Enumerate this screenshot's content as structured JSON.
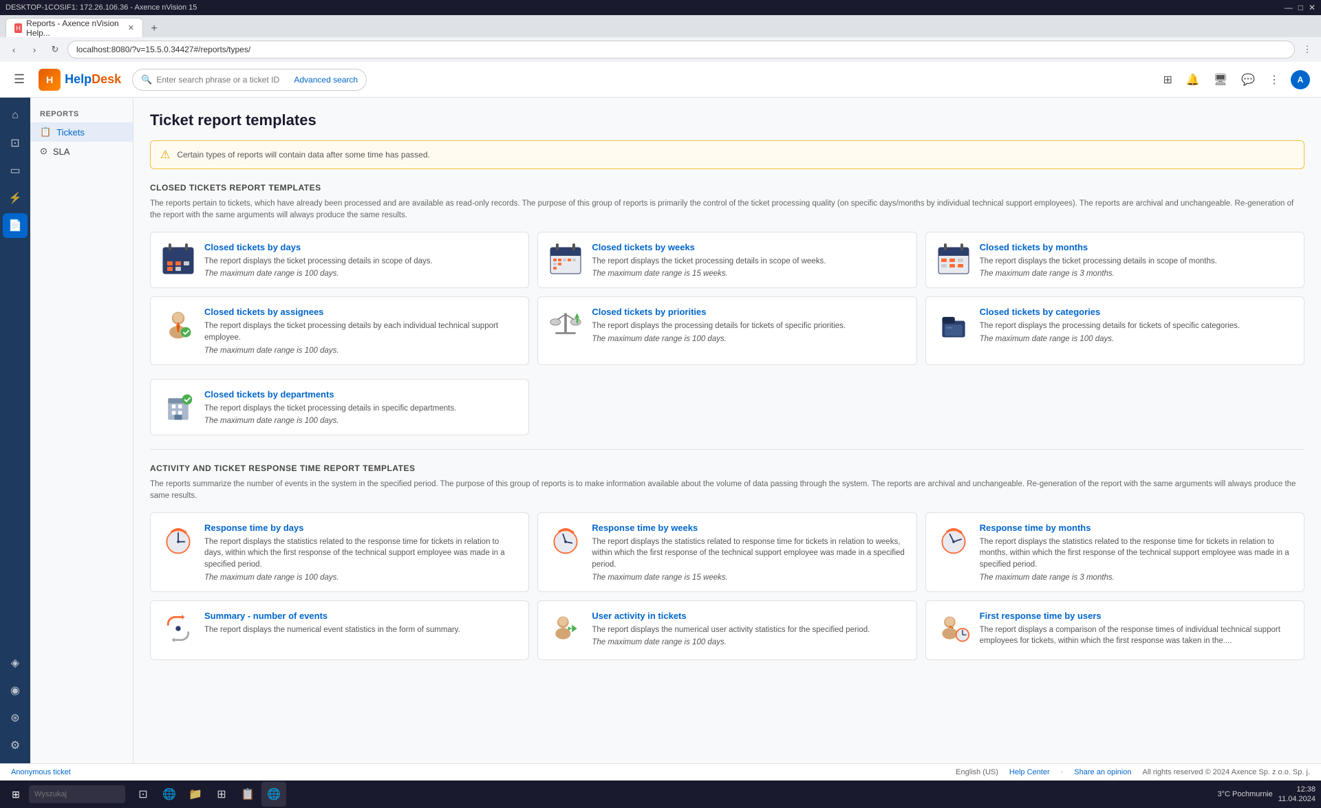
{
  "os": {
    "title": "DESKTOP-1COSIF1: 172.26.106.36 - Axence nVision 15",
    "controls": [
      "—",
      "□",
      "✕"
    ]
  },
  "browser": {
    "tab_label": "Reports - Axence nVision Help...",
    "address": "localhost:8080/?v=15.5.0.34427#/reports/types/",
    "back_btn": "‹",
    "forward_btn": "›",
    "reload_btn": "↻"
  },
  "header": {
    "menu_icon": "☰",
    "logo_text": "HelpDesk",
    "search_placeholder": "Enter search phrase or a ticket ID",
    "advanced_search_label": "Advanced search",
    "icons": {
      "grid": "⊞",
      "bell": "🔔",
      "monitor": "🖥",
      "chat": "💬",
      "apps": "⋮⋮"
    },
    "avatar_label": "A"
  },
  "icon_sidebar": {
    "items": [
      {
        "name": "home",
        "icon": "⌂",
        "active": false
      },
      {
        "name": "map",
        "icon": "⊡",
        "active": false
      },
      {
        "name": "screen",
        "icon": "▭",
        "active": false
      },
      {
        "name": "alert",
        "icon": "⚡",
        "active": false
      },
      {
        "name": "document",
        "icon": "📄",
        "active": true
      },
      {
        "name": "agent",
        "icon": "⚙",
        "active": false
      },
      {
        "name": "network",
        "icon": "◈",
        "active": false
      },
      {
        "name": "eye",
        "icon": "◉",
        "active": false
      },
      {
        "name": "tag",
        "icon": "⊛",
        "active": false
      },
      {
        "name": "settings",
        "icon": "⚙",
        "active": false
      }
    ]
  },
  "nav_sidebar": {
    "section": "REPORTS",
    "items": [
      {
        "label": "Tickets",
        "icon": "📋",
        "active": true
      },
      {
        "label": "SLA",
        "icon": "⊙",
        "active": false
      }
    ]
  },
  "main": {
    "page_title": "Ticket report templates",
    "info_banner": "Certain types of reports will contain data after some time has passed.",
    "sections": [
      {
        "id": "closed_tickets",
        "heading": "CLOSED TICKETS REPORT TEMPLATES",
        "description": "The reports pertain to tickets, which have already been processed and are available as read-only records. The purpose of this group of reports is primarily the control of the ticket processing quality (on specific days/months by individual technical support employees). The reports are archival and unchangeable. Re-generation of the report with the same arguments will always produce the same results.",
        "cards": [
          {
            "title": "Closed tickets by days",
            "desc": "The report displays the ticket processing details in scope of days.",
            "limit": "The maximum date range is 100 days.",
            "icon_type": "calendar-days"
          },
          {
            "title": "Closed tickets by weeks",
            "desc": "The report displays the ticket processing details in scope of weeks.",
            "limit": "The maximum date range is 15 weeks.",
            "icon_type": "calendar-weeks"
          },
          {
            "title": "Closed tickets by months",
            "desc": "The report displays the ticket processing details in scope of months.",
            "limit": "The maximum date range is 3 months.",
            "icon_type": "calendar-months"
          },
          {
            "title": "Closed tickets by assignees",
            "desc": "The report displays the ticket processing details by each individual technical support employee.",
            "limit": "The maximum date range is 100 days.",
            "icon_type": "person-assignees"
          },
          {
            "title": "Closed tickets by priorities",
            "desc": "The report displays the processing details for tickets of specific priorities.",
            "limit": "The maximum date range is 100 days.",
            "icon_type": "scale-priorities"
          },
          {
            "title": "Closed tickets by categories",
            "desc": "The report displays the processing details for tickets of specific categories.",
            "limit": "The maximum date range is 100 days.",
            "icon_type": "folder-categories"
          },
          {
            "title": "Closed tickets by departments",
            "desc": "The report displays the ticket processing details in specific departments.",
            "limit": "The maximum date range is 100 days.",
            "icon_type": "building-departments"
          }
        ]
      },
      {
        "id": "activity_response",
        "heading": "ACTIVITY AND TICKET RESPONSE TIME REPORT TEMPLATES",
        "description": "The reports summarize the number of events in the system in the specified period. The purpose of this group of reports is to make information available about the volume of data passing through the system. The reports are archival and unchangeable. Re-generation of the report with the same arguments will always produce the same results.",
        "cards": [
          {
            "title": "Response time by days",
            "desc": "The report displays the statistics related to the response time for tickets in relation to days, within which the first response of the technical support employee was made in a specified period.",
            "limit": "The maximum date range is 100 days.",
            "icon_type": "clock-days"
          },
          {
            "title": "Response time by weeks",
            "desc": "The report displays the statistics related to response time for tickets in relation to weeks, within which the first response of the technical support employee was made in a specified period.",
            "limit": "The maximum date range is 15 weeks.",
            "icon_type": "clock-weeks"
          },
          {
            "title": "Response time by months",
            "desc": "The report displays the statistics related to the response time for tickets in relation to months, within which the first response of the technical support employee was made in a specified period.",
            "limit": "The maximum date range is 3 months.",
            "icon_type": "clock-months"
          },
          {
            "title": "Summary - number of events",
            "desc": "The report displays the numerical event statistics in the form of summary.",
            "limit": "",
            "icon_type": "summary-events"
          },
          {
            "title": "User activity in tickets",
            "desc": "The report displays the numerical user activity statistics for the specified period.",
            "limit": "The maximum date range is 100 days.",
            "icon_type": "user-activity"
          },
          {
            "title": "First response time by users",
            "desc": "The report displays a comparison of the response times of individual technical support employees for tickets, within which the first response was taken in the....",
            "limit": "",
            "icon_type": "user-response"
          }
        ]
      }
    ]
  },
  "footer": {
    "language": "English (US)",
    "links": [
      "Help Center",
      "Share an opinion"
    ],
    "copyright": "All rights reserved © 2024 Axence Sp. z o.o. Sp. j.",
    "anonymous_ticket": "Anonymous ticket"
  },
  "taskbar": {
    "search_placeholder": "Wyszukaj",
    "time": "12:38",
    "date": "11.04.2024",
    "weather": "3°C  Pochmurnie"
  }
}
